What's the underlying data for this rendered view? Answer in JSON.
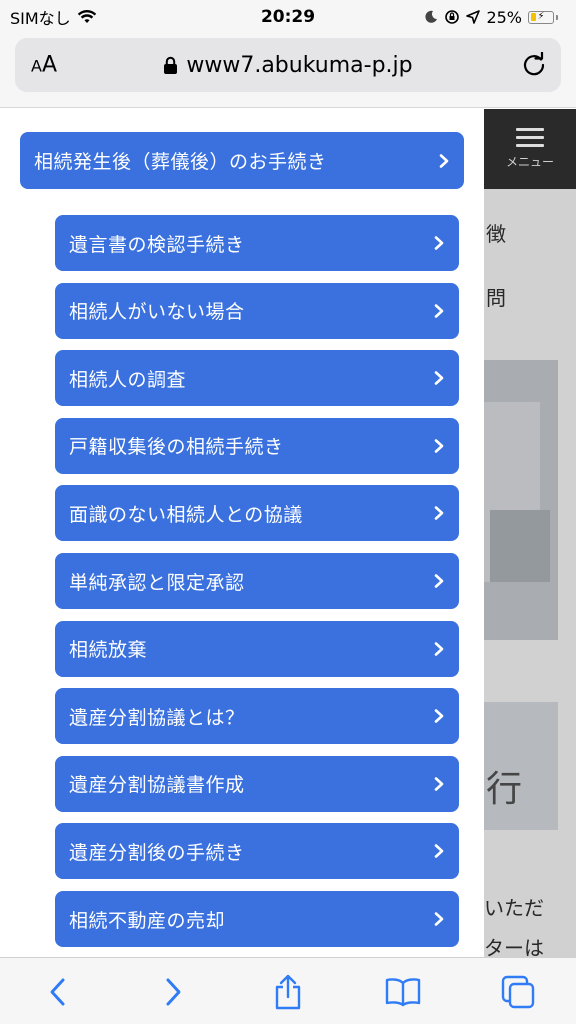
{
  "status_bar": {
    "carrier": "SIMなし",
    "time": "20:29",
    "battery_percent": "25%"
  },
  "browser": {
    "aa_label_small": "A",
    "aa_label_large": "A",
    "url": "www7.abukuma-p.jp"
  },
  "site": {
    "menu_label": "メニュー",
    "bg_text_1": "徴",
    "bg_text_2": "問",
    "bg_text_3": "いただ",
    "bg_text_4": "ターは",
    "bg_text_5": "行"
  },
  "drawer": {
    "parent_label": "相続発生後（葬儀後）のお手続き",
    "items": [
      "遺言書の検認手続き",
      "相続人がいない場合",
      "相続人の調査",
      "戸籍収集後の相続手続き",
      "面識のない相続人との協議",
      "単純承認と限定承認",
      "相続放棄",
      "遺産分割協議とは？",
      "遺産分割協議書作成",
      "遺産分割後の手続き",
      "相続不動産の売却"
    ]
  },
  "colors": {
    "button_blue": "#3a71de",
    "toolbar_tint": "#2f7cf6"
  }
}
